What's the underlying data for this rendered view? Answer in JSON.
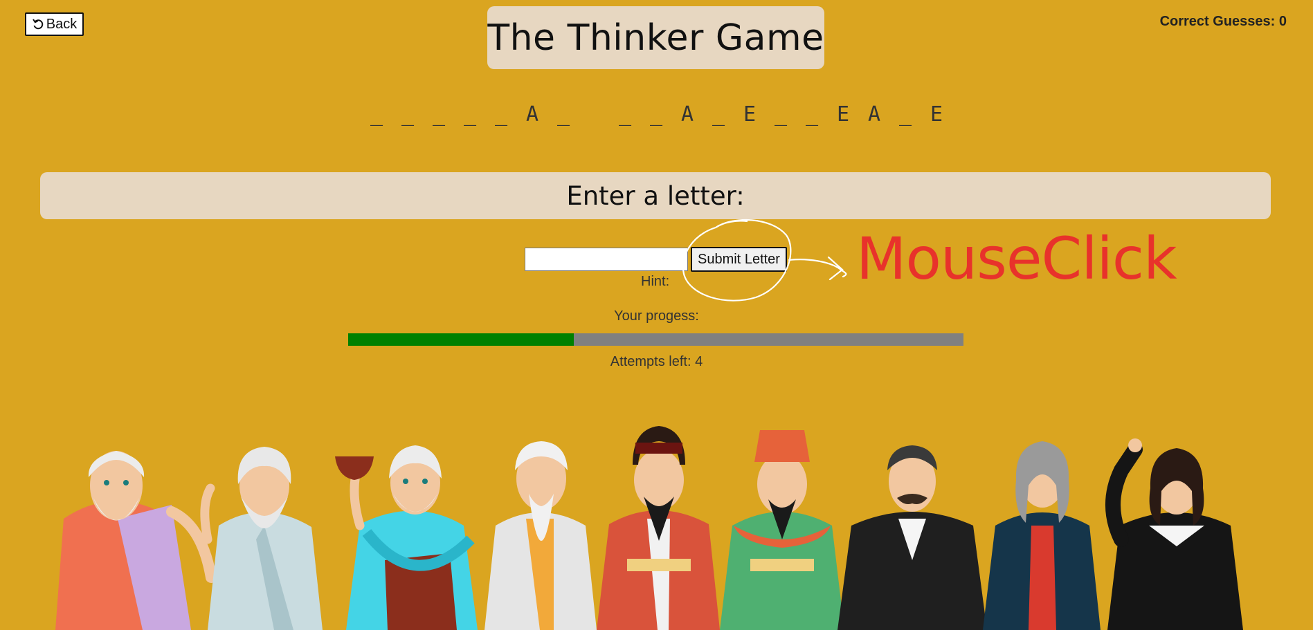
{
  "header": {
    "back_label": "Back",
    "title": "The Thinker Game",
    "correct_guesses": "Correct Guesses: 0"
  },
  "word": {
    "slots": [
      "_",
      "_",
      "_",
      "_",
      "_",
      "A",
      "_",
      " ",
      "_",
      "_",
      "A",
      "_",
      "E",
      "_",
      "_",
      "E",
      "A",
      "_",
      "E"
    ]
  },
  "prompt": {
    "label": "Enter a letter:"
  },
  "letter_input": {
    "value": "",
    "placeholder": ""
  },
  "submit": {
    "label": "Submit Letter"
  },
  "hint": {
    "label": "Hint:"
  },
  "progress": {
    "label": "Your progess:",
    "fraction": 0.367,
    "fill_color": "#008000",
    "track_color": "#808080"
  },
  "attempts": {
    "label": "Attempts left: 4"
  },
  "annotation": {
    "label": "MouseClick",
    "color": "#E8322B"
  },
  "colors": {
    "background": "#DAA520",
    "panel": "#E7D7C1"
  },
  "icons": {
    "back": "undo-arrow-icon"
  }
}
